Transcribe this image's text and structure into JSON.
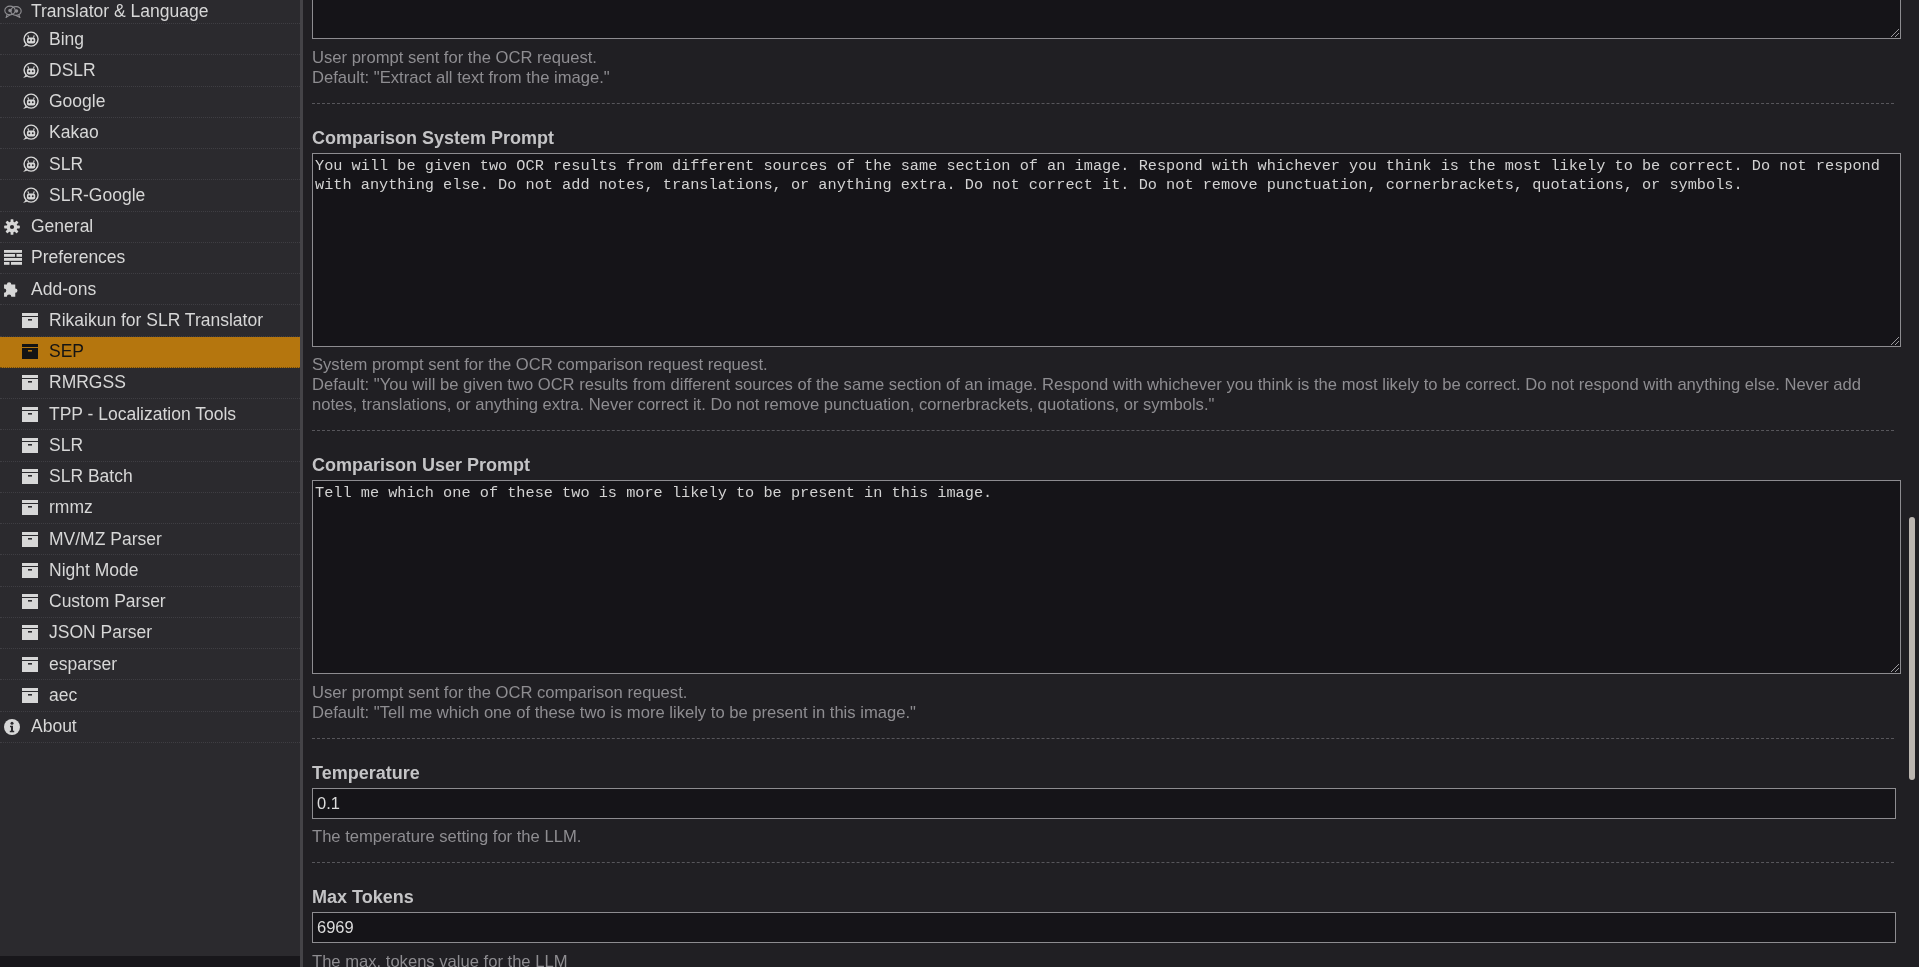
{
  "sidebar": {
    "items": [
      {
        "label": "Translator & Language",
        "kind": "language",
        "selected": false,
        "children": [
          {
            "label": "Bing",
            "selected": false
          },
          {
            "label": "DSLR",
            "selected": false
          },
          {
            "label": "Google",
            "selected": false
          },
          {
            "label": "Kakao",
            "selected": false
          },
          {
            "label": "SLR",
            "selected": false
          },
          {
            "label": "SLR-Google",
            "selected": false
          }
        ]
      },
      {
        "label": "General",
        "kind": "settings",
        "selected": false
      },
      {
        "label": "Preferences",
        "kind": "preferences",
        "selected": false
      },
      {
        "label": "Add-ons",
        "kind": "addons",
        "selected": false,
        "children": [
          {
            "label": "Rikaikun for SLR Translator",
            "selected": false
          },
          {
            "label": "SEP",
            "selected": true
          },
          {
            "label": "RMRGSS",
            "selected": false
          },
          {
            "label": "TPP - Localization Tools",
            "selected": false
          },
          {
            "label": "SLR",
            "selected": false
          },
          {
            "label": "SLR Batch",
            "selected": false
          },
          {
            "label": "rmmz",
            "selected": false
          },
          {
            "label": "MV/MZ Parser",
            "selected": false
          },
          {
            "label": "Night Mode",
            "selected": false
          },
          {
            "label": "Custom Parser",
            "selected": false
          },
          {
            "label": "JSON Parser",
            "selected": false
          },
          {
            "label": "esparser",
            "selected": false
          },
          {
            "label": "aec",
            "selected": false
          }
        ]
      },
      {
        "label": "About",
        "kind": "about",
        "selected": false
      }
    ]
  },
  "settings": [
    {
      "kind": "textarea",
      "help": "User prompt sent for the OCR request.",
      "default": "Default: \"Extract all text from the image.\""
    },
    {
      "kind": "textarea",
      "label": "Comparison System Prompt",
      "value": "You will be given two OCR results from different sources of the same section of an image. Respond with whichever you think is the most likely to be correct. Do not respond with anything else. Do not add notes, translations, or anything extra. Do not correct it. Do not remove punctuation, cornerbrackets, quotations, or symbols.",
      "help": "System prompt sent for the OCR comparison request request.",
      "default": "Default: \"You will be given two OCR results from different sources of the same section of an image. Respond with whichever you think is the most likely to be correct. Do not respond with anything else. Never add notes, translations, or anything extra. Never correct it. Do not remove punctuation, cornerbrackets, quotations, or symbols.\""
    },
    {
      "kind": "textarea",
      "label": "Comparison User Prompt",
      "value": "Tell me which one of these two is more likely to be present in this image.",
      "help": "User prompt sent for the OCR comparison request.",
      "default": "Default: \"Tell me which one of these two is more likely to be present in this image.\""
    },
    {
      "kind": "input",
      "label": "Temperature",
      "value": "0.1",
      "help": "The temperature setting for the LLM."
    },
    {
      "kind": "input",
      "label": "Max Tokens",
      "value": "6969",
      "help": "The max. tokens value for the LLM"
    }
  ]
}
